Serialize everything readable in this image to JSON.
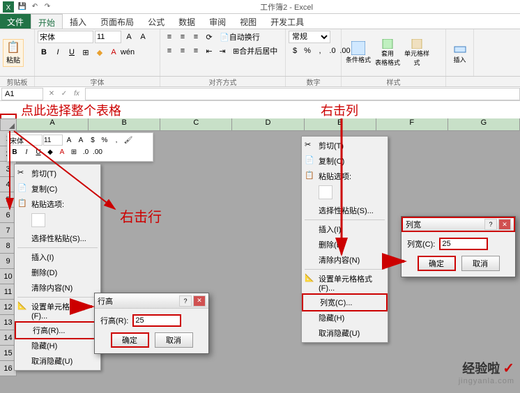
{
  "titlebar": {
    "title": "工作簿2 - Excel"
  },
  "tabs": {
    "file": "文件",
    "home": "开始",
    "insert": "插入",
    "layout": "页面布局",
    "formula": "公式",
    "data": "数据",
    "review": "审阅",
    "view": "视图",
    "dev": "开发工具"
  },
  "ribbon": {
    "paste": "粘贴",
    "font_name": "宋体",
    "font_size": "11",
    "wrap": "自动换行",
    "merge": "合并后居中",
    "number_format": "常规",
    "cond_fmt": "条件格式",
    "table_fmt": "套用\n表格格式",
    "cell_fmt": "单元格样式",
    "insert_btn": "插入",
    "groups": {
      "clipboard": "剪贴板",
      "font": "字体",
      "align": "对齐方式",
      "number": "数字",
      "styles": "样式"
    }
  },
  "namebox": "A1",
  "annotations": {
    "select_all": "点此选择整个表格",
    "right_click_col": "右击列",
    "right_click_row": "右击行"
  },
  "columns": [
    "A",
    "B",
    "C",
    "D",
    "E",
    "F",
    "G"
  ],
  "rows": [
    "1",
    "2",
    "3",
    "4",
    "5",
    "6",
    "7",
    "8",
    "9",
    "10",
    "11",
    "12",
    "13",
    "14",
    "15",
    "16"
  ],
  "minitoolbar": {
    "font": "宋体",
    "size": "11"
  },
  "context_row": {
    "cut": "剪切(T)",
    "copy": "复制(C)",
    "paste_options": "粘贴选项:",
    "paste_special": "选择性粘贴(S)...",
    "insert": "插入(I)",
    "delete": "删除(D)",
    "clear": "清除内容(N)",
    "format": "设置单元格格式(F)...",
    "row_height": "行高(R)...",
    "hide": "隐藏(H)",
    "unhide": "取消隐藏(U)"
  },
  "context_col": {
    "cut": "剪切(T)",
    "copy": "复制(C)",
    "paste_options": "粘贴选项:",
    "paste_special": "选择性粘贴(S)...",
    "insert": "插入(I)",
    "delete": "删除(D)",
    "clear": "清除内容(N)",
    "format": "设置单元格格式(F)...",
    "col_width": "列宽(C)...",
    "hide": "隐藏(H)",
    "unhide": "取消隐藏(U)"
  },
  "dialog_row": {
    "title": "行高",
    "label": "行高(R):",
    "value": "25",
    "ok": "确定",
    "cancel": "取消"
  },
  "dialog_col": {
    "title": "列宽",
    "label": "列宽(C):",
    "value": "25",
    "ok": "确定",
    "cancel": "取消"
  },
  "watermark": {
    "text": "经验啦",
    "check": "✓",
    "url": "jingyanla.com"
  }
}
